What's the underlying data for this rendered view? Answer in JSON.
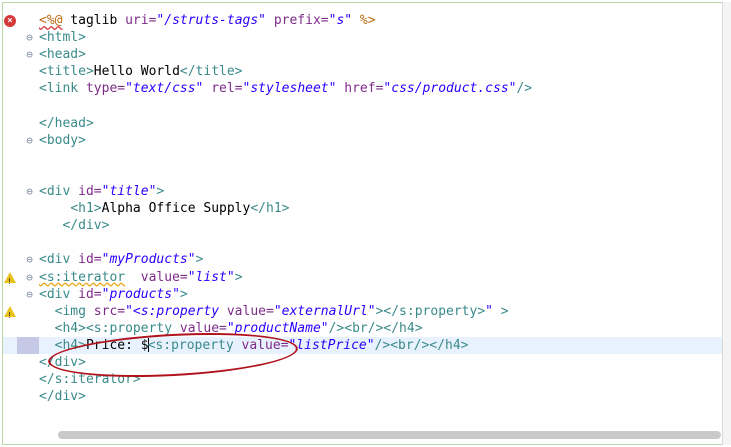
{
  "editor": {
    "lines": [
      {
        "id": "l1",
        "marker": "error",
        "fold": "",
        "parts": [
          {
            "c": "t-dir squiggle",
            "t": "<%@"
          },
          {
            "c": "t-text",
            "t": " taglib "
          },
          {
            "c": "t-attr",
            "t": "uri="
          },
          {
            "c": "t-val",
            "t": "\"/struts-tags\""
          },
          {
            "c": "t-attr",
            "t": " prefix="
          },
          {
            "c": "t-val",
            "t": "\"s\""
          },
          {
            "c": "t-dir",
            "t": " %>"
          }
        ]
      },
      {
        "id": "l2",
        "marker": "",
        "fold": "⊖",
        "parts": [
          {
            "c": "t-tag",
            "t": "<html>"
          }
        ]
      },
      {
        "id": "l3",
        "marker": "",
        "fold": "⊖",
        "parts": [
          {
            "c": "t-tag",
            "t": "<head>"
          }
        ]
      },
      {
        "id": "l4",
        "marker": "",
        "fold": "",
        "parts": [
          {
            "c": "t-tag",
            "t": "<title>"
          },
          {
            "c": "t-text",
            "t": "Hello World"
          },
          {
            "c": "t-tag",
            "t": "</title>"
          }
        ]
      },
      {
        "id": "l5",
        "marker": "",
        "fold": "",
        "parts": [
          {
            "c": "t-tag",
            "t": "<link "
          },
          {
            "c": "t-attr",
            "t": "type="
          },
          {
            "c": "t-val",
            "t": "\"text/css\""
          },
          {
            "c": "t-attr",
            "t": " rel="
          },
          {
            "c": "t-val",
            "t": "\"stylesheet\""
          },
          {
            "c": "t-attr",
            "t": " href="
          },
          {
            "c": "t-val",
            "t": "\"css/product.css\""
          },
          {
            "c": "t-tag",
            "t": "/>"
          }
        ]
      },
      {
        "id": "l6",
        "marker": "",
        "fold": "",
        "parts": []
      },
      {
        "id": "l7",
        "marker": "",
        "fold": "",
        "parts": [
          {
            "c": "t-tag",
            "t": "</head>"
          }
        ]
      },
      {
        "id": "l8",
        "marker": "",
        "fold": "⊖",
        "parts": [
          {
            "c": "t-tag",
            "t": "<body>"
          }
        ]
      },
      {
        "id": "l9",
        "marker": "",
        "fold": "",
        "parts": []
      },
      {
        "id": "l10",
        "marker": "",
        "fold": "",
        "parts": []
      },
      {
        "id": "l11",
        "marker": "",
        "fold": "⊖",
        "parts": [
          {
            "c": "t-tag",
            "t": "<div "
          },
          {
            "c": "t-attr",
            "t": "id="
          },
          {
            "c": "t-val",
            "t": "\"title\""
          },
          {
            "c": "t-tag",
            "t": ">"
          }
        ]
      },
      {
        "id": "l12",
        "marker": "",
        "fold": "",
        "parts": [
          {
            "c": "t-text",
            "t": "    "
          },
          {
            "c": "t-tag",
            "t": "<h1>"
          },
          {
            "c": "t-text",
            "t": "Alpha Office Supply"
          },
          {
            "c": "t-tag",
            "t": "</h1>"
          }
        ]
      },
      {
        "id": "l13",
        "marker": "",
        "fold": "",
        "parts": [
          {
            "c": "t-text",
            "t": "   "
          },
          {
            "c": "t-tag",
            "t": "</div>"
          }
        ]
      },
      {
        "id": "l14",
        "marker": "",
        "fold": "",
        "parts": []
      },
      {
        "id": "l15",
        "marker": "",
        "fold": "⊖",
        "parts": [
          {
            "c": "t-tag",
            "t": "<div "
          },
          {
            "c": "t-attr",
            "t": "id="
          },
          {
            "c": "t-val",
            "t": "\"myProducts\""
          },
          {
            "c": "t-tag",
            "t": ">"
          }
        ]
      },
      {
        "id": "l16",
        "marker": "warning",
        "fold": "⊖",
        "parts": [
          {
            "c": "t-tag squiggle-warn",
            "t": "<s:iterator"
          },
          {
            "c": "t-text",
            "t": "  "
          },
          {
            "c": "t-attr",
            "t": "value="
          },
          {
            "c": "t-val",
            "t": "\"list\""
          },
          {
            "c": "t-tag",
            "t": ">"
          }
        ]
      },
      {
        "id": "l17",
        "marker": "",
        "fold": "⊖",
        "parts": [
          {
            "c": "t-tag",
            "t": "<div "
          },
          {
            "c": "t-attr",
            "t": "id="
          },
          {
            "c": "t-val",
            "t": "\"products\""
          },
          {
            "c": "t-tag",
            "t": ">"
          }
        ]
      },
      {
        "id": "l18",
        "marker": "warning",
        "fold": "",
        "parts": [
          {
            "c": "t-text",
            "t": "  "
          },
          {
            "c": "t-tag",
            "t": "<img "
          },
          {
            "c": "t-attr",
            "t": "src="
          },
          {
            "c": "t-val",
            "t": "\"<s:property "
          },
          {
            "c": "t-attr",
            "t": "value="
          },
          {
            "c": "t-val",
            "t": "\"externalUrl\""
          },
          {
            "c": "t-tag",
            "t": "></s:property>"
          },
          {
            "c": "t-val",
            "t": "\""
          },
          {
            "c": "t-tag",
            "t": " >"
          }
        ]
      },
      {
        "id": "l19",
        "marker": "",
        "fold": "",
        "parts": [
          {
            "c": "t-text",
            "t": "  "
          },
          {
            "c": "t-tag",
            "t": "<h4><s:property "
          },
          {
            "c": "t-attr",
            "t": "value="
          },
          {
            "c": "t-val",
            "t": "\"productName\""
          },
          {
            "c": "t-tag",
            "t": "/><br/></h4>"
          }
        ]
      },
      {
        "id": "l20",
        "marker": "current",
        "fold": "",
        "parts": [
          {
            "c": "t-text",
            "t": "  "
          },
          {
            "c": "t-tag",
            "t": "<h4>"
          },
          {
            "c": "t-text",
            "t": "Price: $"
          },
          {
            "c": "caret",
            "t": ""
          },
          {
            "c": "t-tag",
            "t": "<s:property "
          },
          {
            "c": "t-attr",
            "t": "value="
          },
          {
            "c": "t-val",
            "t": "\"listPrice\""
          },
          {
            "c": "t-tag",
            "t": "/><br/></h4>"
          }
        ]
      },
      {
        "id": "l21",
        "marker": "",
        "fold": "",
        "parts": [
          {
            "c": "t-tag",
            "t": "</div>"
          }
        ]
      },
      {
        "id": "l22",
        "marker": "",
        "fold": "",
        "parts": [
          {
            "c": "t-tag",
            "t": "</s:iterator>"
          }
        ]
      },
      {
        "id": "l23",
        "marker": "",
        "fold": "",
        "parts": [
          {
            "c": "t-tag",
            "t": "</div>"
          }
        ]
      }
    ]
  },
  "colors": {
    "tag": "#3a8a8a",
    "attribute": "#7f2b8a",
    "value": "#2a00ff",
    "directive": "#bd6a10",
    "annotation_circle": "#b0121b",
    "current_line": "#e8f2fe"
  },
  "icons": {
    "error": "error-icon",
    "warning": "warning-icon",
    "fold": "fold-collapse-icon"
  }
}
